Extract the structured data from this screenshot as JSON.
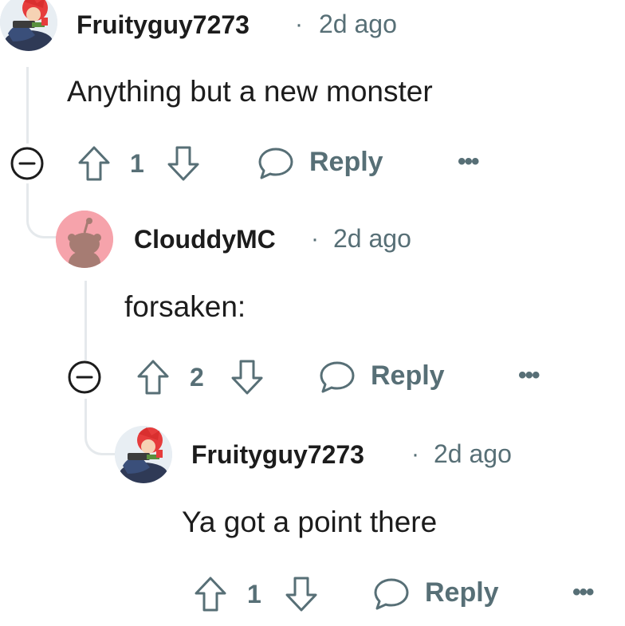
{
  "comments": [
    {
      "username": "Fruityguy7273",
      "separator": "·",
      "time": "2d ago",
      "text": "Anything but a new monster",
      "votes": "1",
      "reply_label": "Reply",
      "more": "•••"
    },
    {
      "username": "ClouddyMC",
      "separator": "·",
      "time": "2d ago",
      "text": "forsaken:",
      "votes": "2",
      "reply_label": "Reply",
      "more": "•••"
    },
    {
      "username": "Fruityguy7273",
      "separator": "·",
      "time": "2d ago",
      "text": "Ya got a point there",
      "votes": "1",
      "reply_label": "Reply",
      "more": "•••"
    }
  ],
  "colors": {
    "text": "#1c1c1c",
    "meta": "#576f76",
    "thread_line": "#e5e9ec",
    "snoo_background": "#f6a3ab",
    "snoo_body": "#a67c73"
  }
}
